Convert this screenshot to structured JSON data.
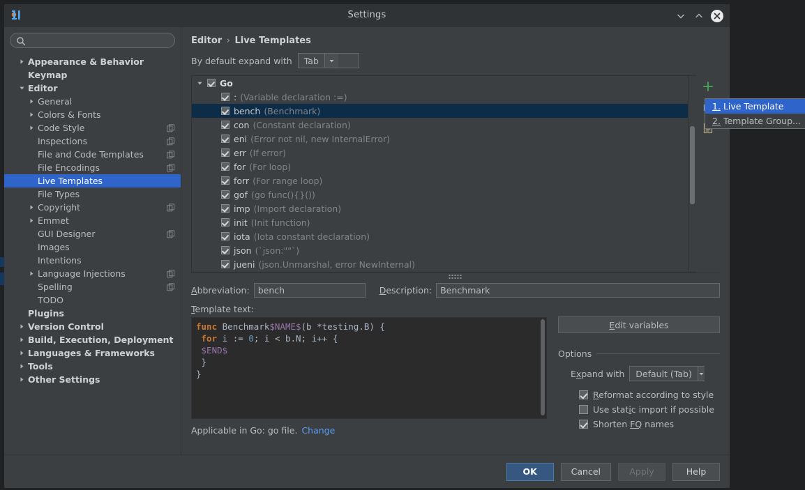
{
  "window": {
    "title": "Settings",
    "logo_icon": "intellij-logo-icon",
    "controls": [
      {
        "name": "minimize-button",
        "icon": "chevron-down-icon"
      },
      {
        "name": "maximize-button",
        "icon": "chevron-up-icon"
      },
      {
        "name": "close-button",
        "icon": "close-circle-icon"
      }
    ]
  },
  "search": {
    "value": "",
    "placeholder": "",
    "icon": "search-icon"
  },
  "sidebar": {
    "items": [
      {
        "label": "Appearance & Behavior",
        "indent": 0,
        "arrow": "right",
        "bold": true,
        "copy": false,
        "selected": false
      },
      {
        "label": "Keymap",
        "indent": 0,
        "arrow": "none",
        "bold": true,
        "copy": false,
        "selected": false
      },
      {
        "label": "Editor",
        "indent": 0,
        "arrow": "down",
        "bold": true,
        "copy": false,
        "selected": false
      },
      {
        "label": "General",
        "indent": 1,
        "arrow": "right",
        "bold": false,
        "copy": false,
        "selected": false
      },
      {
        "label": "Colors & Fonts",
        "indent": 1,
        "arrow": "right",
        "bold": false,
        "copy": false,
        "selected": false
      },
      {
        "label": "Code Style",
        "indent": 1,
        "arrow": "right",
        "bold": false,
        "copy": true,
        "selected": false
      },
      {
        "label": "Inspections",
        "indent": 1,
        "arrow": "none",
        "bold": false,
        "copy": true,
        "selected": false
      },
      {
        "label": "File and Code Templates",
        "indent": 1,
        "arrow": "none",
        "bold": false,
        "copy": true,
        "selected": false
      },
      {
        "label": "File Encodings",
        "indent": 1,
        "arrow": "none",
        "bold": false,
        "copy": true,
        "selected": false
      },
      {
        "label": "Live Templates",
        "indent": 1,
        "arrow": "none",
        "bold": false,
        "copy": false,
        "selected": true
      },
      {
        "label": "File Types",
        "indent": 1,
        "arrow": "none",
        "bold": false,
        "copy": false,
        "selected": false
      },
      {
        "label": "Copyright",
        "indent": 1,
        "arrow": "right",
        "bold": false,
        "copy": true,
        "selected": false
      },
      {
        "label": "Emmet",
        "indent": 1,
        "arrow": "right",
        "bold": false,
        "copy": false,
        "selected": false
      },
      {
        "label": "GUI Designer",
        "indent": 1,
        "arrow": "none",
        "bold": false,
        "copy": true,
        "selected": false
      },
      {
        "label": "Images",
        "indent": 1,
        "arrow": "none",
        "bold": false,
        "copy": false,
        "selected": false
      },
      {
        "label": "Intentions",
        "indent": 1,
        "arrow": "none",
        "bold": false,
        "copy": false,
        "selected": false
      },
      {
        "label": "Language Injections",
        "indent": 1,
        "arrow": "right",
        "bold": false,
        "copy": true,
        "selected": false
      },
      {
        "label": "Spelling",
        "indent": 1,
        "arrow": "none",
        "bold": false,
        "copy": true,
        "selected": false
      },
      {
        "label": "TODO",
        "indent": 1,
        "arrow": "none",
        "bold": false,
        "copy": false,
        "selected": false
      },
      {
        "label": "Plugins",
        "indent": 0,
        "arrow": "none",
        "bold": true,
        "copy": false,
        "selected": false
      },
      {
        "label": "Version Control",
        "indent": 0,
        "arrow": "right",
        "bold": true,
        "copy": false,
        "selected": false
      },
      {
        "label": "Build, Execution, Deployment",
        "indent": 0,
        "arrow": "right",
        "bold": true,
        "copy": false,
        "selected": false
      },
      {
        "label": "Languages & Frameworks",
        "indent": 0,
        "arrow": "right",
        "bold": true,
        "copy": false,
        "selected": false
      },
      {
        "label": "Tools",
        "indent": 0,
        "arrow": "right",
        "bold": true,
        "copy": false,
        "selected": false
      },
      {
        "label": "Other Settings",
        "indent": 0,
        "arrow": "right",
        "bold": true,
        "copy": false,
        "selected": false
      }
    ]
  },
  "main": {
    "breadcrumb": {
      "parent": "Editor",
      "separator": "›",
      "current": "Live Templates"
    },
    "expand_default": {
      "label": "By default expand with",
      "value": "Tab"
    },
    "toolbar": [
      {
        "name": "add-template-button",
        "icon": "plus-icon"
      },
      {
        "name": "copy-template-button",
        "icon": "copy-icon"
      },
      {
        "name": "template-options-button",
        "icon": "document-icon"
      }
    ],
    "popup_menu": {
      "items": [
        {
          "mnemonic": "1.",
          "label": "Live Template",
          "highlighted": true
        },
        {
          "mnemonic": "2.",
          "label": "Template Group...",
          "highlighted": false
        }
      ]
    },
    "templates": {
      "group": {
        "label": "Go",
        "checked": true,
        "expanded": true
      },
      "items": [
        {
          "abbr": ":",
          "desc": "(Variable declaration :=)",
          "checked": true,
          "selected": false
        },
        {
          "abbr": "bench",
          "desc": "(Benchmark)",
          "checked": true,
          "selected": true
        },
        {
          "abbr": "con",
          "desc": "(Constant declaration)",
          "checked": true,
          "selected": false
        },
        {
          "abbr": "eni",
          "desc": "(Error not nil, new InternalError)",
          "checked": true,
          "selected": false
        },
        {
          "abbr": "err",
          "desc": "(If error)",
          "checked": true,
          "selected": false
        },
        {
          "abbr": "for",
          "desc": "(For loop)",
          "checked": true,
          "selected": false
        },
        {
          "abbr": "forr",
          "desc": "(For range loop)",
          "checked": true,
          "selected": false
        },
        {
          "abbr": "gof",
          "desc": "(go func(){}())",
          "checked": true,
          "selected": false
        },
        {
          "abbr": "imp",
          "desc": "(Import declaration)",
          "checked": true,
          "selected": false
        },
        {
          "abbr": "init",
          "desc": "(Init function)",
          "checked": true,
          "selected": false
        },
        {
          "abbr": "iota",
          "desc": "(Iota constant declaration)",
          "checked": true,
          "selected": false
        },
        {
          "abbr": "json",
          "desc": "(`json:\"\"`)",
          "checked": true,
          "selected": false
        },
        {
          "abbr": "jueni",
          "desc": "(json.Unmarshal, error NewInternal)",
          "checked": true,
          "selected": false
        }
      ]
    },
    "form": {
      "abbreviation_label": "Abbreviation:",
      "abbreviation_value": "bench",
      "description_label": "Description:",
      "description_value": "Benchmark",
      "template_text_label": "Template text:",
      "template_code_lines": [
        [
          {
            "t": "func ",
            "c": "k-key"
          },
          {
            "t": "Benchmark",
            "c": "k-pln"
          },
          {
            "t": "$NAME$",
            "c": "k-fn"
          },
          {
            "t": "(b *testing.B) {",
            "c": "k-pln"
          }
        ],
        [
          {
            "t": " ",
            "c": "k-pln"
          },
          {
            "t": "for ",
            "c": "k-key"
          },
          {
            "t": "i := ",
            "c": "k-pln"
          },
          {
            "t": "0",
            "c": "k-num"
          },
          {
            "t": "; i < b.N; i++ {",
            "c": "k-pln"
          }
        ],
        [
          {
            "t": " ",
            "c": "k-pln"
          },
          {
            "t": "$END$",
            "c": "k-fn"
          }
        ],
        [
          {
            "t": " }",
            "c": "k-pln"
          }
        ],
        [
          {
            "t": "}",
            "c": "k-pln"
          }
        ]
      ],
      "applicable_text": "Applicable in Go: go file.",
      "change_link": "Change",
      "edit_variables_label": "Edit variables",
      "options_title": "Options",
      "expand_with_label": "Expand with",
      "expand_with_value": "Default (Tab)",
      "checkboxes": [
        {
          "label": "Reformat according to style",
          "checked": true,
          "mnemonic": "R"
        },
        {
          "label": "Use static import if possible",
          "checked": false,
          "mnemonic": "i"
        },
        {
          "label": "Shorten FQ names",
          "checked": true,
          "mnemonic": "FQ"
        }
      ]
    }
  },
  "footer": {
    "buttons": [
      {
        "label": "OK",
        "style": "primary"
      },
      {
        "label": "Cancel",
        "style": "normal"
      },
      {
        "label": "Apply",
        "style": "disabled"
      },
      {
        "label": "Help",
        "style": "normal"
      }
    ]
  },
  "colors": {
    "accent_selection": "#2f65ca",
    "list_selection": "#0d2c48",
    "window_bg": "#3c3f41",
    "titlebar_bg": "#303336",
    "code_bg": "#2b2b2b",
    "link": "#589df6",
    "primary_button": "#365880",
    "plus_green": "#499c54"
  }
}
